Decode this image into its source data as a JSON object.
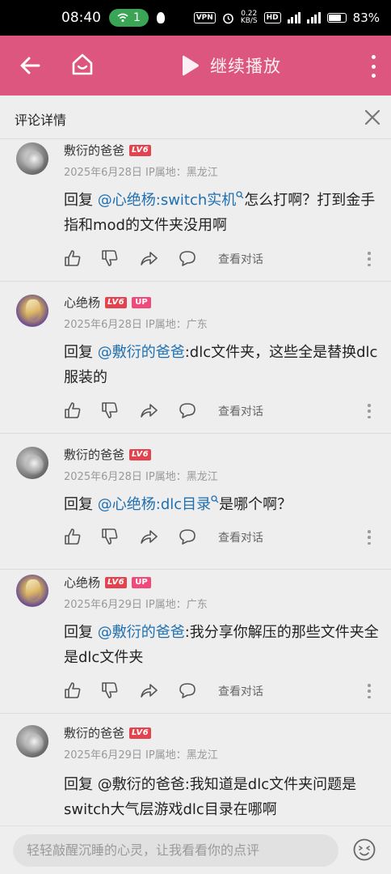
{
  "status_bar": {
    "time": "08:40",
    "wifi_count": "1",
    "vpn": "VPN",
    "speed_value": "0.22",
    "speed_unit": "KB/S",
    "hd": "HD",
    "battery": "83%"
  },
  "header": {
    "title": "继续播放",
    "color": "#dd5680"
  },
  "panel": {
    "title": "评论详情"
  },
  "actions": {
    "view_conversation": "查看对话"
  },
  "comments": [
    {
      "user": "敷衍的爸爸",
      "level": "LV6",
      "up": "",
      "date": "2025年6月28日",
      "location": "IP属地：黑龙江",
      "reply_prefix": "回复",
      "mention": "@心绝杨",
      "segments": [
        ":",
        "switch实机",
        "怎么打啊？打到金手指和mod的文件夹没用啊"
      ]
    },
    {
      "user": "心绝杨",
      "level": "LV6",
      "up": "UP",
      "date": "2025年6月28日",
      "location": "IP属地：广东",
      "reply_prefix": "回复",
      "mention": "@敷衍的爸爸",
      "segments": [
        ":dlc文件夹，这些全是替换dlc服装的"
      ]
    },
    {
      "user": "敷衍的爸爸",
      "level": "LV6",
      "up": "",
      "date": "2025年6月28日",
      "location": "IP属地：黑龙江",
      "reply_prefix": "回复",
      "mention": "@心绝杨",
      "segments": [
        ":",
        "dlc目录",
        "是哪个啊？"
      ]
    },
    {
      "user": "心绝杨",
      "level": "LV6",
      "up": "UP",
      "date": "2025年6月29日",
      "location": "IP属地：广东",
      "reply_prefix": "回复",
      "mention": "@敷衍的爸爸",
      "segments": [
        ":我分享你解压的那些文件夹全是dlc文件夹"
      ]
    },
    {
      "user": "敷衍的爸爸",
      "level": "LV6",
      "up": "",
      "date": "2025年6月29日",
      "location": "IP属地：黑龙江",
      "reply_prefix": "回复",
      "mention": "@敷衍的爸爸",
      "segments": [
        ":我知道是dlc文件夹问题是switch大气层游戏dlc目录在哪啊"
      ]
    }
  ],
  "input": {
    "placeholder": "轻轻敲醒沉睡的心灵，让我看看你的点评"
  }
}
